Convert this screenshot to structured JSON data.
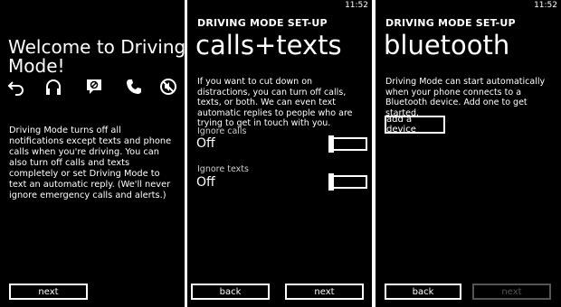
{
  "screens": {
    "welcome": {
      "title": "Welcome to Driving Mode!",
      "icons": [
        "undo-icon",
        "headphones-icon",
        "message-blocked-icon",
        "phone-icon",
        "mute-icon"
      ],
      "description": "Driving Mode turns off all notifications except texts and phone calls when you're driving. You can also turn off calls and texts completely or set Driving Mode to text an automatic reply. (We'll never ignore emergency calls and alerts.)",
      "next_label": "next"
    },
    "calls_texts": {
      "time": "11:52",
      "eyebrow": "DRIVING MODE SET-UP",
      "title": "calls+texts",
      "description": "If you want to cut down on distractions, you can turn off calls, texts, or both. We can even text automatic replies to people who are trying to get in touch with you.",
      "ignore_calls_label": "Ignore calls",
      "ignore_calls_value": "Off",
      "ignore_texts_label": "Ignore texts",
      "ignore_texts_value": "Off",
      "back_label": "back",
      "next_label": "next"
    },
    "bluetooth": {
      "time": "11:52",
      "eyebrow": "DRIVING MODE SET-UP",
      "title": "bluetooth",
      "description": "Driving Mode can start automatically when your phone connects to a Bluetooth device. Add one to get started.",
      "add_device_label": "add a device",
      "back_label": "back",
      "next_label": "next"
    }
  },
  "colors": {
    "background": "#000000",
    "foreground": "#ffffff",
    "disabled": "#555555"
  }
}
